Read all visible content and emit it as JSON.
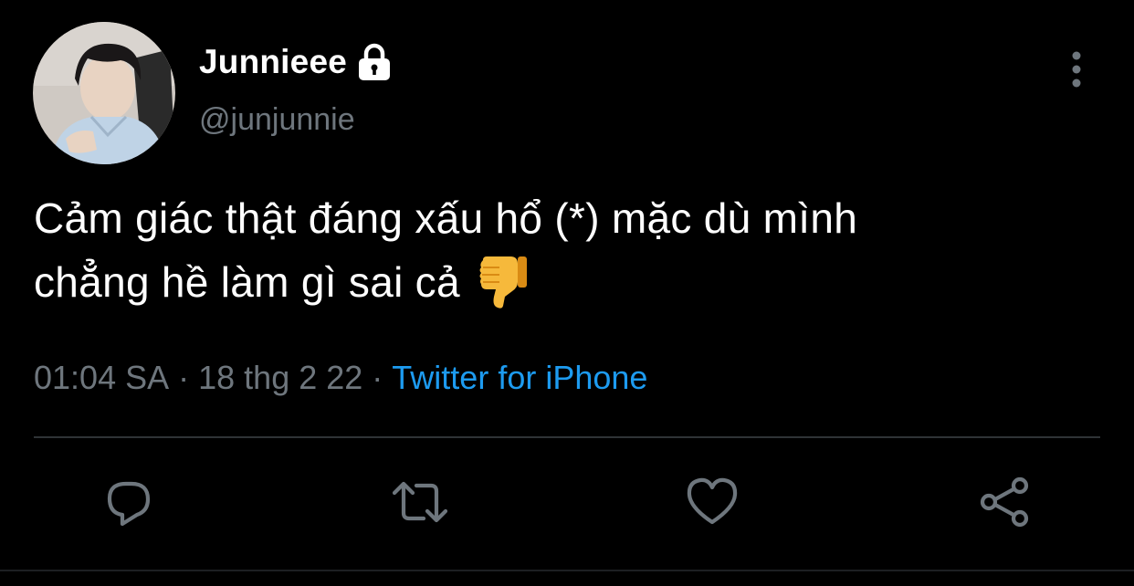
{
  "user": {
    "display_name": "Junnieee",
    "handle": "@junjunnie",
    "protected_icon": "lock-icon",
    "avatar": "profile-photo"
  },
  "tweet": {
    "text": "Cảm giác thật đáng xấu hổ (*) mặc dù mình\nchẳng hề làm gì sai cả ",
    "emoji": "👎",
    "emoji_icon": "thumbs-down-icon"
  },
  "meta": {
    "time": "01:04 SA",
    "separator": "·",
    "date": "18 thg 2 22",
    "source": "Twitter for iPhone"
  },
  "actions": [
    {
      "name": "reply",
      "icon": "reply-icon"
    },
    {
      "name": "retweet",
      "icon": "retweet-icon"
    },
    {
      "name": "like",
      "icon": "heart-icon"
    },
    {
      "name": "share",
      "icon": "share-icon"
    }
  ],
  "colors": {
    "background": "#000000",
    "primary_text": "#ffffff",
    "secondary_text": "#6e767d",
    "accent": "#1d9bf0",
    "divider": "#2f3336"
  }
}
